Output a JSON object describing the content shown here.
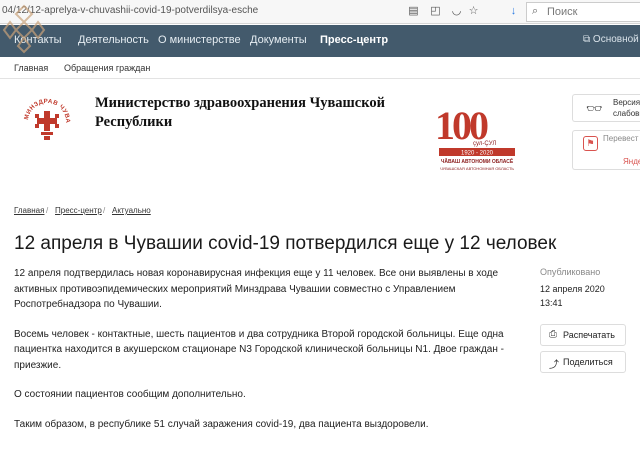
{
  "browser": {
    "url": "04/12/12-aprelya-v-chuvashii-covid-19-potverdilsya-esche",
    "search_placeholder": "Поиск",
    "icons": [
      "reader-view-icon",
      "screenshot-icon",
      "pocket-icon",
      "bookmark-star-icon",
      "download-icon"
    ]
  },
  "topnav": {
    "items": [
      "Контакты",
      "Деятельность",
      "О министерстве",
      "Документы",
      "Пресс-центр"
    ],
    "active": "Пресс-центр",
    "right_link": "Основной по"
  },
  "subnav": {
    "items": [
      "Главная",
      "Обращения граждан"
    ]
  },
  "header": {
    "title": "Министерство здравоохранения Чувашской Республики",
    "emblem_text": "МИНЗДРАВ ЧУВАШИИ",
    "anniversary": {
      "number": "100",
      "years": "çул-ÇУЛ",
      "period": "1920 - 2020",
      "line1": "ЧĂВАШ АВТОНОМИ ОБЛАСĚ",
      "line2": "ЧУВАШСКАЯ АВТОНОМНАЯ ОБЛАСТЬ"
    },
    "accessibility": {
      "line1": "Версия д",
      "line2": "слабови"
    },
    "translate": {
      "line1": "Перевест",
      "line2": "Янде"
    }
  },
  "breadcrumb": [
    "Главная",
    "Пресс-центр",
    "Актуально"
  ],
  "article": {
    "title": "12 апреля в Чувашии covid-19 потвердился еще у 12 человек",
    "paragraphs": [
      "12 апреля подтвердилась новая коронавирусная инфекция еще у 11 человек. Все они выявлены в ходе активных противоэпидемических мероприятий Минздрава Чувашии совместно с Управлением Роспотребнадзора по Чувашии.",
      "Восемь человек - контактные, шесть пациентов и два сотрудника Второй городской больницы. Еще одна пациентка находится в акушерском стационаре N3 Городской клинической больницы N1. Двое граждан - приезжие.",
      "О состоянии пациентов сообщим дополнительно.",
      "Таким образом, в республике 51 случай заражения covid-19, два пациента выздоровели."
    ]
  },
  "meta": {
    "published_label": "Опубликовано",
    "date": "12 апреля 2020",
    "time": "13:41",
    "print_label": "Распечатать",
    "share_label": "Поделиться"
  },
  "colors": {
    "nav_bg": "#435a6c",
    "brand_red": "#c0392b"
  }
}
